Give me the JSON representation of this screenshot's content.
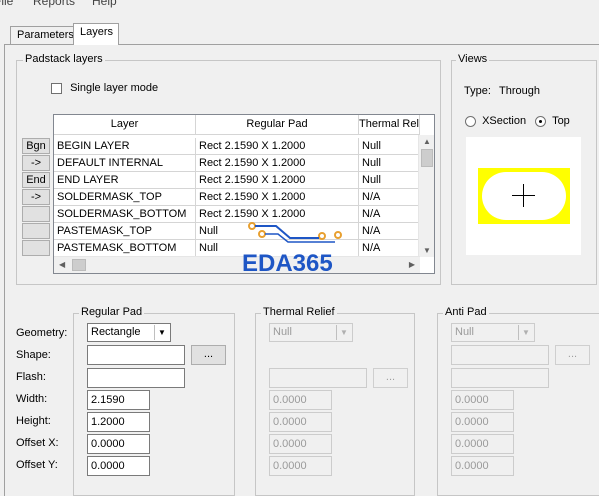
{
  "menu": {
    "file": "File",
    "reports": "Reports",
    "help": "Help"
  },
  "tabs": {
    "parameters": "Parameters",
    "layers": "Layers"
  },
  "padstack_layers": {
    "title": "Padstack layers",
    "single_layer_mode": "Single layer mode",
    "columns": {
      "layer": "Layer",
      "regular_pad": "Regular Pad",
      "thermal_relief": "Thermal Relief"
    },
    "row_buttons": {
      "bgn": "Bgn",
      "arrow1": "->",
      "end": "End",
      "arrow2": "->"
    },
    "rows": [
      {
        "layer": "BEGIN LAYER",
        "regular_pad": "Rect 2.1590 X 1.2000",
        "thermal": "Null"
      },
      {
        "layer": "DEFAULT INTERNAL",
        "regular_pad": "Rect 2.1590 X 1.2000",
        "thermal": "Null"
      },
      {
        "layer": "END LAYER",
        "regular_pad": "Rect 2.1590 X 1.2000",
        "thermal": "Null"
      },
      {
        "layer": "SOLDERMASK_TOP",
        "regular_pad": "Rect 2.1590 X 1.2000",
        "thermal": "N/A"
      },
      {
        "layer": "SOLDERMASK_BOTTOM",
        "regular_pad": "Rect 2.1590 X 1.2000",
        "thermal": "N/A"
      },
      {
        "layer": "PASTEMASK_TOP",
        "regular_pad": "Null",
        "thermal": "N/A"
      },
      {
        "layer": "PASTEMASK_BOTTOM",
        "regular_pad": "Null",
        "thermal": "N/A"
      }
    ]
  },
  "views": {
    "title": "Views",
    "type_label": "Type:",
    "type_value": "Through",
    "xsection": "XSection",
    "top": "Top",
    "selected": "Top"
  },
  "fields": {
    "geometry": "Geometry:",
    "shape": "Shape:",
    "flash": "Flash:",
    "width": "Width:",
    "height": "Height:",
    "offset_x": "Offset X:",
    "offset_y": "Offset Y:"
  },
  "regular_pad": {
    "title": "Regular Pad",
    "geometry": "Rectangle",
    "shape": "",
    "flash": "",
    "width": "2.1590",
    "height": "1.2000",
    "offset_x": "0.0000",
    "offset_y": "0.0000",
    "browse": "..."
  },
  "thermal_relief": {
    "title": "Thermal Relief",
    "geometry": "Null",
    "width": "0.0000",
    "height": "0.0000",
    "offset_x": "0.0000",
    "offset_y": "0.0000",
    "browse": "..."
  },
  "anti_pad": {
    "title": "Anti Pad",
    "geometry": "Null",
    "width": "0.0000",
    "height": "0.0000",
    "offset_x": "0.0000",
    "offset_y": "0.0000",
    "browse": "..."
  },
  "watermark": "EDA365",
  "colors": {
    "pad_fill": "#ffff00",
    "watermark": "#1e56c5",
    "watermark_trace": "#e8a030"
  }
}
